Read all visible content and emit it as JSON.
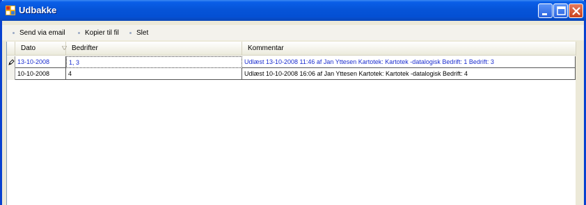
{
  "window": {
    "title": "Udbakke"
  },
  "toolbar": {
    "items": [
      {
        "label": "Send via email"
      },
      {
        "label": "Kopier til fil"
      },
      {
        "label": "Slet"
      }
    ]
  },
  "grid": {
    "columns": [
      {
        "label": "Dato"
      },
      {
        "label": "Bedrifter"
      },
      {
        "label": "Kommentar"
      }
    ],
    "rows": [
      {
        "dato": "13-10-2008",
        "bedrifter": "1, 3",
        "kommentar": "Udlæst 13-10-2008 11:46 af Jan Yttesen Kartotek: Kartotek -datalogisk Bedrift: 1 Bedrift: 3",
        "selected": true,
        "editing": true
      },
      {
        "dato": "10-10-2008",
        "bedrifter": "4",
        "kommentar": "Udlæst 10-10-2008 16:06 af Jan Yttesen Kartotek: Kartotek -datalogisk Bedrift: 4",
        "selected": false,
        "editing": false
      }
    ]
  },
  "colors": {
    "titlebar": "#0654d8",
    "selected_text": "#1a2ccf"
  },
  "icons": {
    "window": "app-grid-icon",
    "edit": "pencil-icon",
    "sort": "sort-indicator-icon"
  }
}
